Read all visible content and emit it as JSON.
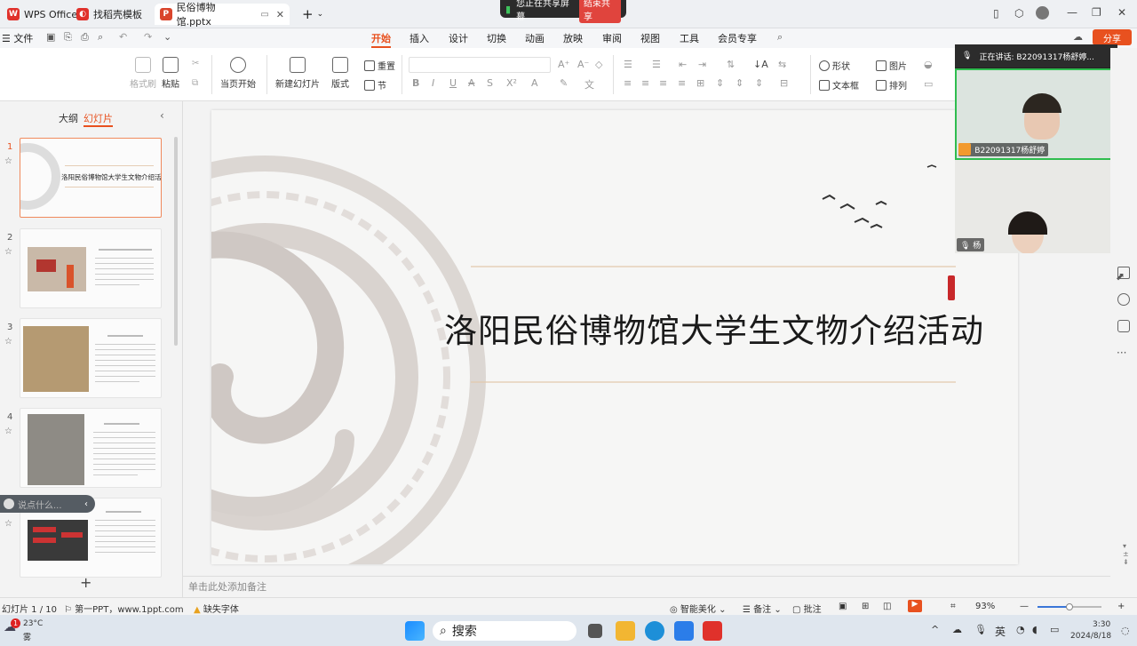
{
  "titlebar": {
    "app_tab": "WPS Office",
    "template_tab": "找稻壳模板",
    "doc_tab": "民俗博物馆.pptx",
    "new_tab": "+"
  },
  "share_bar": {
    "status": "您正在共享屏幕",
    "end_button": "结束共享"
  },
  "menu": {
    "file": "文件",
    "tabs": [
      "开始",
      "插入",
      "设计",
      "切换",
      "动画",
      "放映",
      "审阅",
      "视图",
      "工具",
      "会员专享"
    ],
    "active": "开始",
    "share_button": "分享"
  },
  "ribbon": {
    "format_painter": "格式刷",
    "paste": "粘贴",
    "play_from_current": "当页开始",
    "new_slide": "新建幻灯片",
    "layout": "版式",
    "reset": "重置",
    "section": "节",
    "shape": "形状",
    "picture": "图片",
    "textbox": "文本框",
    "arrange": "排列"
  },
  "left_panel": {
    "tab_outline": "大纲",
    "tab_slides": "幻灯片",
    "thumb1_title": "洛阳民俗博物馆大学生文物介绍活动",
    "add": "+"
  },
  "chat_input": {
    "placeholder": "说点什么..."
  },
  "slide": {
    "title": "洛阳民俗博物馆大学生文物介绍活动"
  },
  "notes": {
    "placeholder": "单击此处添加备注"
  },
  "statusbar": {
    "slide_counter": "幻灯片 1 / 10",
    "theme": "第一PPT，www.1ppt.com",
    "missing_font": "缺失字体",
    "smart_beautify": "智能美化",
    "notes": "备注",
    "comments": "批注",
    "zoom": "93%"
  },
  "video_panel": {
    "speaking": "正在讲话:  B22091317杨舒婷...",
    "participant1": "B22091317杨舒婷",
    "participant2": "杨"
  },
  "taskbar": {
    "weather_temp": "23°C",
    "weather_desc": "雾",
    "weather_badge": "1",
    "search": "搜索",
    "ime": "英",
    "time": "3:30",
    "date": "2024/8/18"
  },
  "colors": {
    "accent": "#e8511f",
    "share_end": "#e0443d",
    "thumb_selected": "#f08a5d",
    "video_active": "#2fbd4f"
  }
}
